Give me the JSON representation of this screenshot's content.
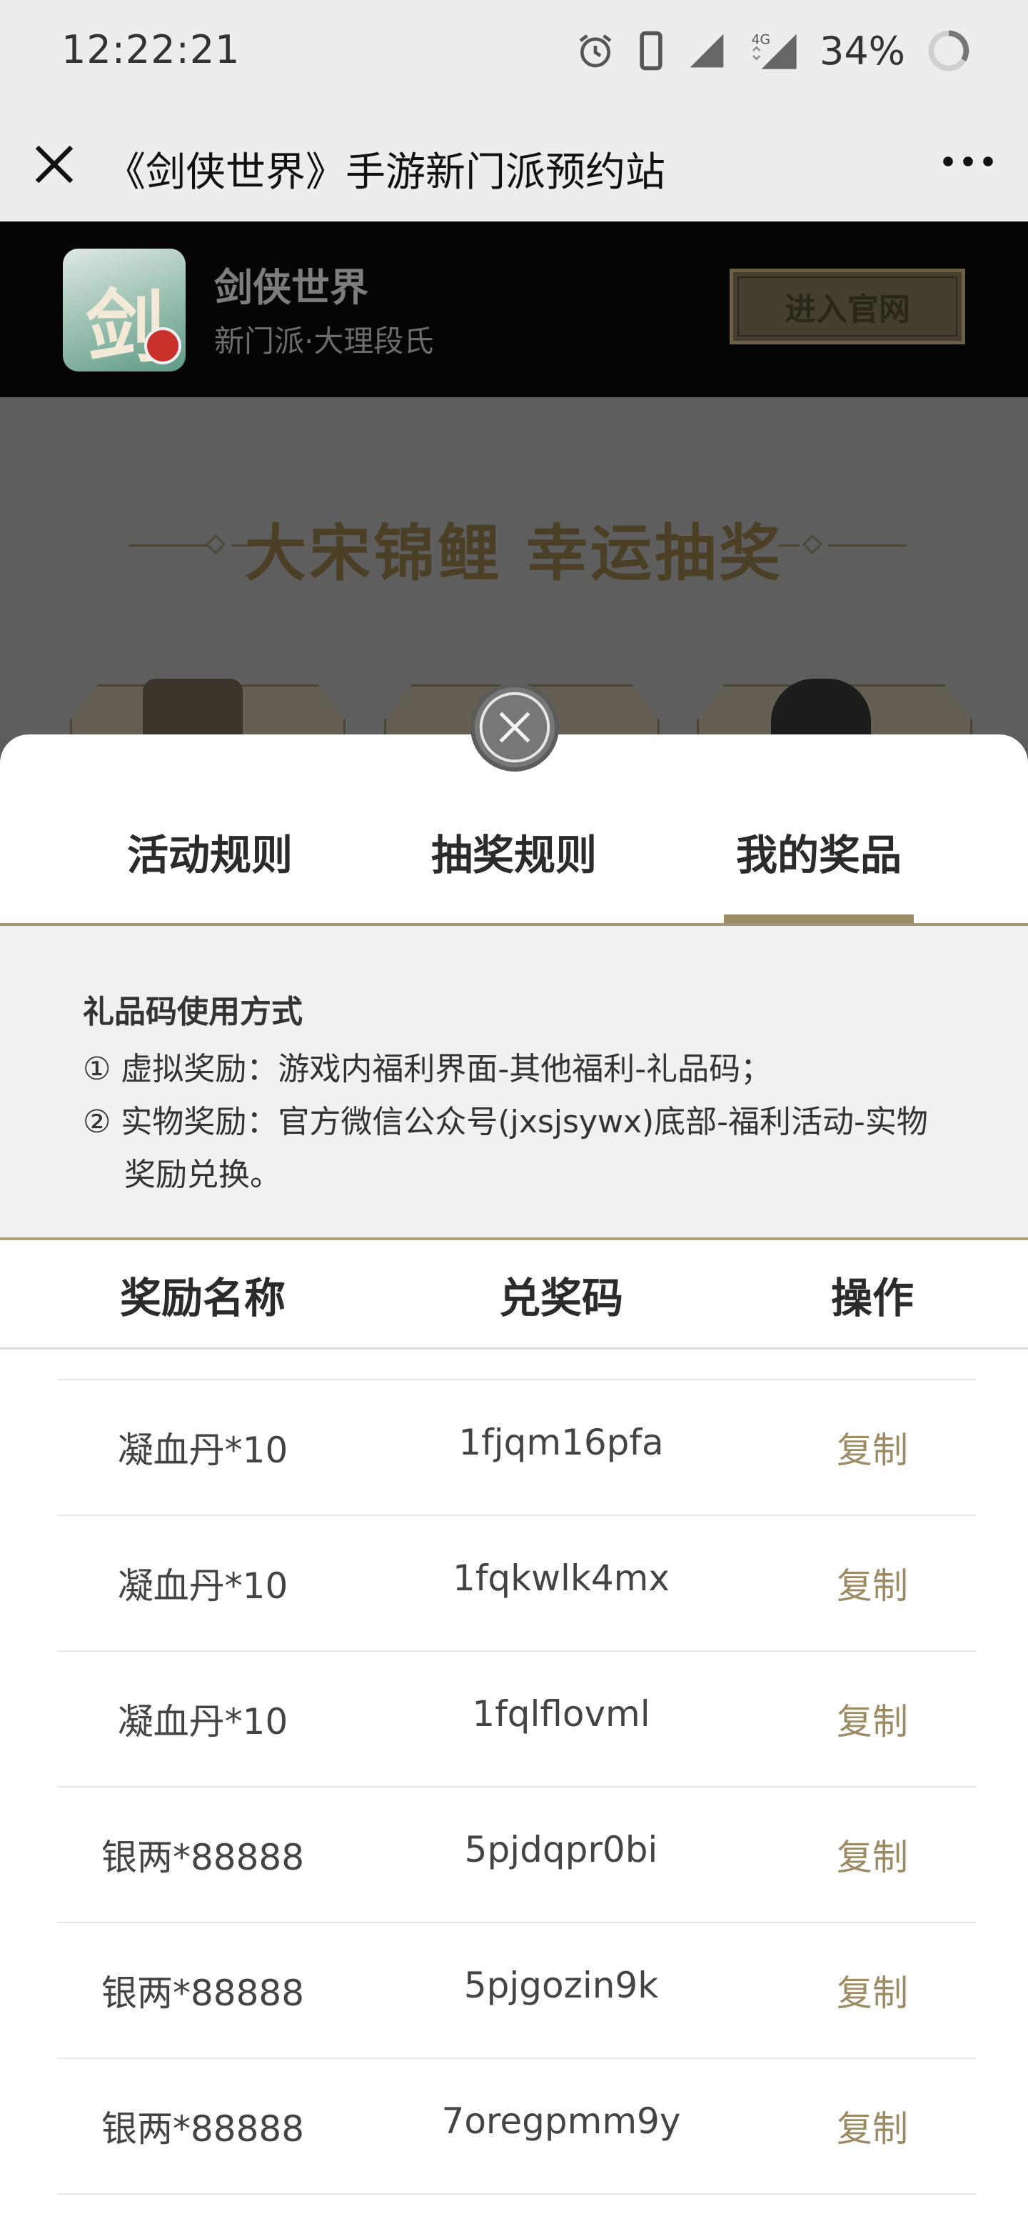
{
  "status_bar": {
    "time": "12:22:21",
    "battery": "34%",
    "network": "4G"
  },
  "nav": {
    "title": "《剑侠世界》手游新门派预约站"
  },
  "app_banner": {
    "name": "剑侠世界",
    "subtitle": "新门派·大理段氏",
    "button": "进入官网",
    "icon_glyph": "剑"
  },
  "page": {
    "lottery_title": "大宋锦鲤  幸运抽奖"
  },
  "tabs": [
    {
      "label": "活动规则",
      "active": false
    },
    {
      "label": "抽奖规则",
      "active": false
    },
    {
      "label": "我的奖品",
      "active": true
    }
  ],
  "info": {
    "title": "礼品码使用方式",
    "line1": "① 虚拟奖励：游戏内福利界面-其他福利-礼品码；",
    "line2": "② 实物奖励：官方微信公众号(jxsjsywx)底部-福利活动-实物",
    "line3": "奖励兑换。"
  },
  "table": {
    "headers": [
      "奖励名称",
      "兑奖码",
      "操作"
    ],
    "rows": [
      {
        "name": "凝血丹*10",
        "code": "1fjqm16pfa",
        "action": "复制"
      },
      {
        "name": "凝血丹*10",
        "code": "1fqkwlk4mx",
        "action": "复制"
      },
      {
        "name": "凝血丹*10",
        "code": "1fqlflovml",
        "action": "复制"
      },
      {
        "name": "银两*88888",
        "code": "5pjdqpr0bi",
        "action": "复制"
      },
      {
        "name": "银两*88888",
        "code": "5pjgozin9k",
        "action": "复制"
      },
      {
        "name": "银两*88888",
        "code": "7oregpmm9y",
        "action": "复制"
      }
    ]
  },
  "colors": {
    "accent": "#9c8b65",
    "sheet_bg": "#ffffff",
    "info_bg": "#f1f1f1"
  }
}
